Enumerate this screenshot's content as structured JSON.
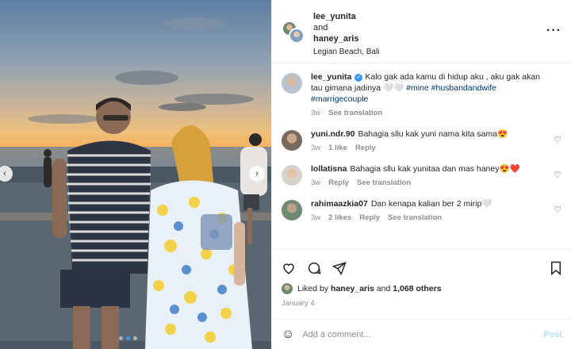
{
  "header": {
    "user1": "lee_yunita",
    "and": "and",
    "user2": "haney_aris",
    "location": "Legian Beach, Bali",
    "more_icon": "more-horizontal-icon"
  },
  "caption": {
    "user": "lee_yunita",
    "text": "Kalo gak ada kamu di hidup aku , aku gak akan tau gimana jadinya 🤍🤍 ",
    "hashtags": "#mine #husbandandwife #marrigecouple",
    "time": "3w",
    "see_translation": "See translation"
  },
  "comments": [
    {
      "user": "yuni.ndr.90",
      "text": "Bahagia sllu kak yuni nama kita sama😍",
      "time": "3w",
      "likes": "1 like",
      "reply": "Reply",
      "translation": ""
    },
    {
      "user": "lollatisna",
      "text": "Bahagia sllu kak yunitaa dan mas haney😍❤️",
      "time": "3w",
      "likes": "",
      "reply": "Reply",
      "translation": "See translation"
    },
    {
      "user": "rahimaazkia07",
      "text": "Dan kenapa kalian ber 2 mirip🤍",
      "time": "3w",
      "likes": "2 likes",
      "reply": "Reply",
      "translation": "See translation"
    }
  ],
  "actions": {
    "like_icon": "heart-icon",
    "comment_icon": "comment-icon",
    "share_icon": "share-icon",
    "save_icon": "bookmark-icon"
  },
  "likes": {
    "prefix": "Liked by",
    "user": "haney_aris",
    "and": "and",
    "others": "1,068 others"
  },
  "date": "January 4",
  "add_comment": {
    "placeholder": "Add a comment...",
    "post_label": "Post"
  },
  "carousel": {
    "prev": "‹",
    "next": "›",
    "active_index": 1,
    "count": 3
  }
}
